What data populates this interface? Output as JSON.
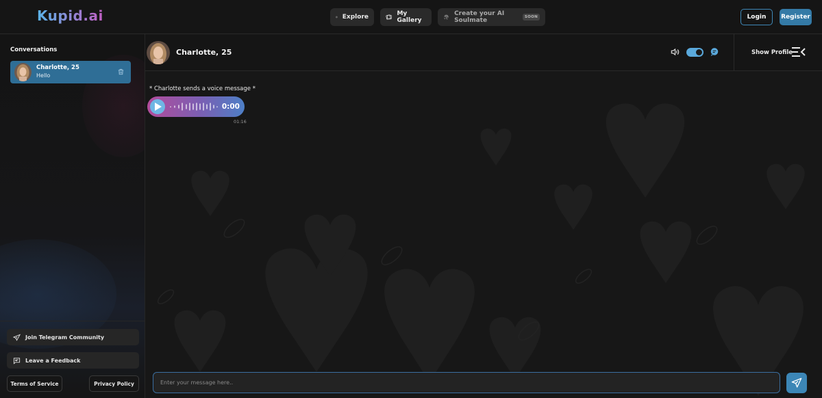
{
  "app": {
    "logo": "Kupid.ai"
  },
  "nav": {
    "explore_label": "Explore",
    "gallery_label": "My Gallery",
    "create_label": "Create your AI Soulmate",
    "create_badge": "SOON"
  },
  "auth": {
    "login_label": "Login",
    "register_label": "Register"
  },
  "sidebar": {
    "title": "Conversations",
    "conversations": [
      {
        "name": "Charlotte, 25",
        "last_message": "Hello"
      }
    ],
    "telegram_label": "Join Telegram Community",
    "feedback_label": "Leave a Feedback",
    "terms_label": "Terms of Service",
    "privacy_label": "Privacy Policy"
  },
  "chat": {
    "name": "Charlotte, 25",
    "show_profile_label": "Show Profile",
    "voice_toggle_on": true,
    "messages": [
      {
        "type": "system",
        "text": "* Charlotte sends a voice message *"
      },
      {
        "type": "voice",
        "duration": "0:00",
        "time": "01:16"
      }
    ],
    "input_placeholder": "Enter your message here.."
  },
  "colors": {
    "accent": "#347aa6",
    "active_conversation": "#2f6e96",
    "voice_gradient_start": "#b34c9b",
    "voice_gradient_end": "#4d7fc6"
  },
  "icons": [
    "compass-icon",
    "gallery-icon",
    "fingerprint-icon",
    "trash-icon",
    "telegram-icon",
    "feedback-icon",
    "speaker-icon",
    "chat-bubble-icon",
    "menu-collapse-icon",
    "play-icon",
    "send-icon"
  ]
}
